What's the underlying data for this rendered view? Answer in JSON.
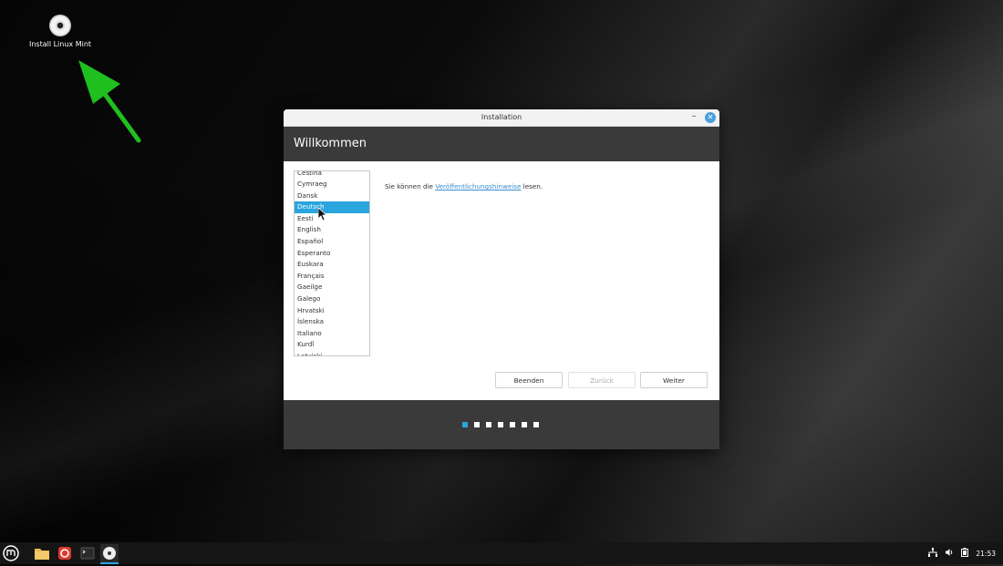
{
  "desktop": {
    "icon_label": "Install Linux Mint"
  },
  "window": {
    "title": "Installation",
    "minimize_glyph": "–",
    "close_glyph": "✕",
    "header": "Willkommen",
    "languages": [
      "Čeština",
      "Cymraeg",
      "Dansk",
      "Deutsch",
      "Eesti",
      "English",
      "Español",
      "Esperanto",
      "Euskara",
      "Français",
      "Gaeilge",
      "Galego",
      "Hrvatski",
      "Íslenska",
      "Italiano",
      "Kurdî",
      "Latviski"
    ],
    "selected_language": "Deutsch",
    "notes_prefix": "Sie können die ",
    "notes_link": "Veröffentlichungshinweise",
    "notes_suffix": " lesen.",
    "buttons": {
      "quit": "Beenden",
      "back": "Zurück",
      "next": "Weiter"
    },
    "progress": {
      "current": 1,
      "total": 7
    }
  },
  "taskbar": {
    "clock": "21:53"
  },
  "colors": {
    "accent": "#2aa5de",
    "header_bg": "#3a3a3a",
    "arrow": "#1fbf1f"
  }
}
